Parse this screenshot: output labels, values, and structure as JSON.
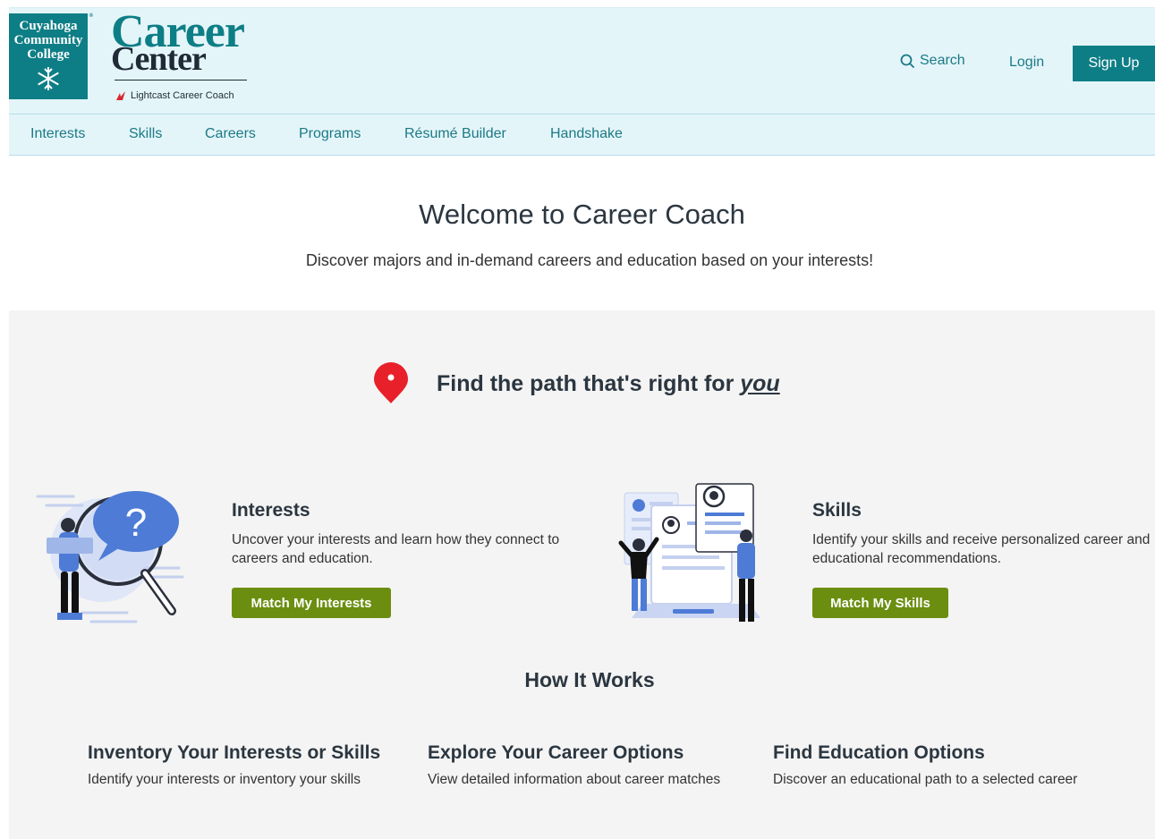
{
  "colors": {
    "teal": "#0e7e86",
    "nav_bg": "#e4f5f9",
    "link": "#1a7a86",
    "button_green": "#6b8e10",
    "pin_red": "#e8202a",
    "illustration_blue": "#4d7bd6"
  },
  "header": {
    "college_logo": {
      "line1": "Cuyahoga",
      "line2": "Community",
      "line3": "College",
      "mark": "®"
    },
    "career_center_logo": {
      "word1": "Career",
      "word2": "Center",
      "sub": "Lightcast Career Coach"
    },
    "search_label": "Search",
    "login_label": "Login",
    "signup_label": "Sign Up"
  },
  "nav": {
    "items": [
      "Interests",
      "Skills",
      "Careers",
      "Programs",
      "Résumé Builder",
      "Handshake"
    ]
  },
  "welcome": {
    "title": "Welcome to Career Coach",
    "subtitle": "Discover majors and in-demand careers and education based on your interests!"
  },
  "path": {
    "title_prefix": "Find the path that's right for ",
    "title_emphasis": "you",
    "icon": "map-pin-icon"
  },
  "cards": [
    {
      "title": "Interests",
      "description": "Uncover your interests and learn how they connect to careers and education.",
      "button": "Match My Interests",
      "illustration": "magnifier-question-illustration"
    },
    {
      "title": "Skills",
      "description": "Identify your skills and receive personalized career and educational recommendations.",
      "button": "Match My Skills",
      "illustration": "resume-laptop-illustration"
    }
  ],
  "how_it_works": {
    "title": "How It Works",
    "steps": [
      {
        "title": "Inventory Your Interests or Skills",
        "description": "Identify your interests or inventory your skills"
      },
      {
        "title": "Explore Your Career Options",
        "description": "View detailed information about career matches"
      },
      {
        "title": "Find Education Options",
        "description": "Discover an educational path to a selected career"
      }
    ]
  }
}
